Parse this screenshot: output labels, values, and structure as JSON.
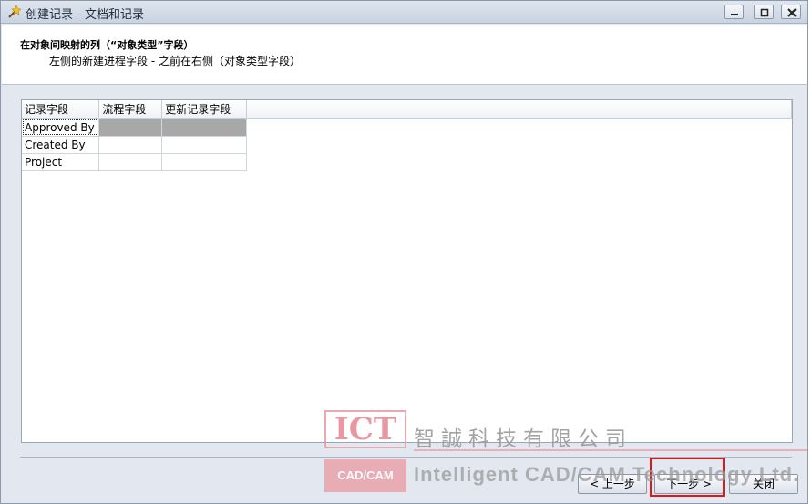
{
  "window": {
    "title": "创建记录 - 文档和记录",
    "controls": {
      "minimize_icon": "minimize-icon",
      "maximize_icon": "maximize-icon",
      "close_icon": "close-icon"
    }
  },
  "header": {
    "title": "在对象间映射的列（“对象类型”字段）",
    "subtitle": "左侧的新建进程字段 - 之前在右侧（对象类型字段）"
  },
  "grid": {
    "columns": [
      "记录字段",
      "流程字段",
      "更新记录字段"
    ],
    "rows": [
      {
        "record_field": "Approved By",
        "process_field": "",
        "update_field": ""
      },
      {
        "record_field": "Created By",
        "process_field": "",
        "update_field": ""
      },
      {
        "record_field": "Project",
        "process_field": "",
        "update_field": ""
      }
    ]
  },
  "footer": {
    "back_label": "< 上一步",
    "next_label": "下一步 >",
    "close_label": "关闭"
  },
  "watermark": {
    "logo_top": "ICT",
    "logo_bottom": "CAD/CAM",
    "company_cn": "智誠科技有限公司",
    "company_en": "Intelligent CAD/CAM Technology Ltd."
  },
  "colors": {
    "highlight": "#e01818",
    "selected_cell": "#a8a8a8"
  }
}
